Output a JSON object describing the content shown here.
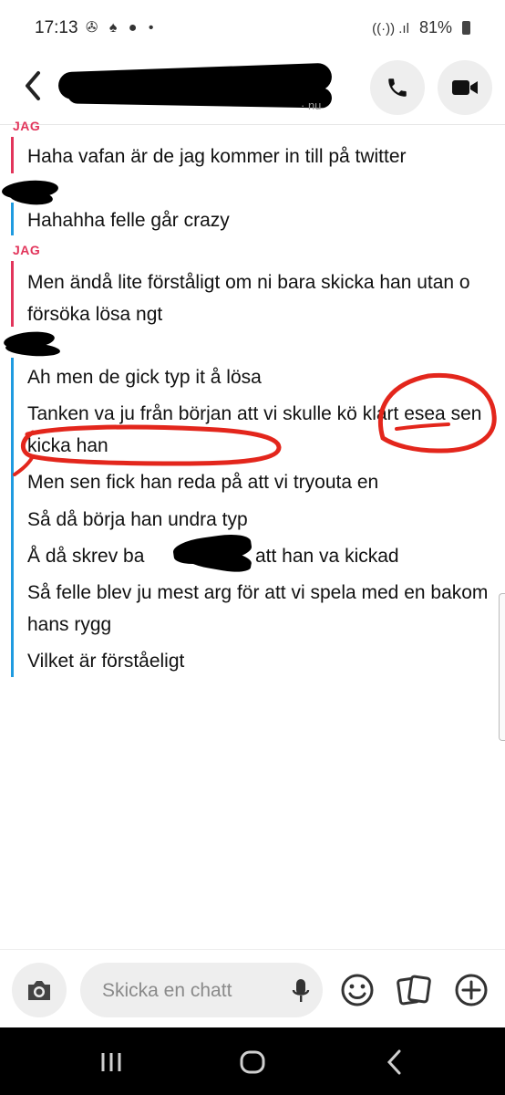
{
  "status_bar": {
    "time": "17:13",
    "battery": "81%"
  },
  "header": {
    "subtitle": "· nu"
  },
  "messages": [
    {
      "sender": "JAG",
      "lines": [
        "Haha vafan är de jag kommer in till på twitter"
      ]
    },
    {
      "sender": "",
      "lines": [
        "Hahahha felle går crazy"
      ]
    },
    {
      "sender": "JAG",
      "lines": [
        "Men ändå lite förståligt om ni bara skicka han utan o försöka lösa ngt"
      ]
    },
    {
      "sender": "",
      "lines": [
        "Ah men de gick typ it å lösa",
        "Tanken va ju från början att vi skulle kö klart esea sen kicka han",
        "Men sen fick han reda på att vi tryouta en",
        "Så då börja han undra typ",
        "Å då skrev ba",
        "att han va kickad",
        "Så felle blev ju mest arg för att vi spela med en bakom hans rygg",
        "Vilket är förståeligt"
      ]
    }
  ],
  "input": {
    "placeholder": "Skicka en chatt"
  },
  "icons": [
    "back-icon",
    "phone-icon",
    "video-icon",
    "camera-icon",
    "mic-icon",
    "emoji-icon",
    "stickers-icon",
    "plus-icon",
    "recents-icon",
    "home-icon",
    "nav-back-icon"
  ],
  "colors": {
    "me": "#e2355b",
    "them": "#1f9be0",
    "annotation": "#e3261c"
  }
}
